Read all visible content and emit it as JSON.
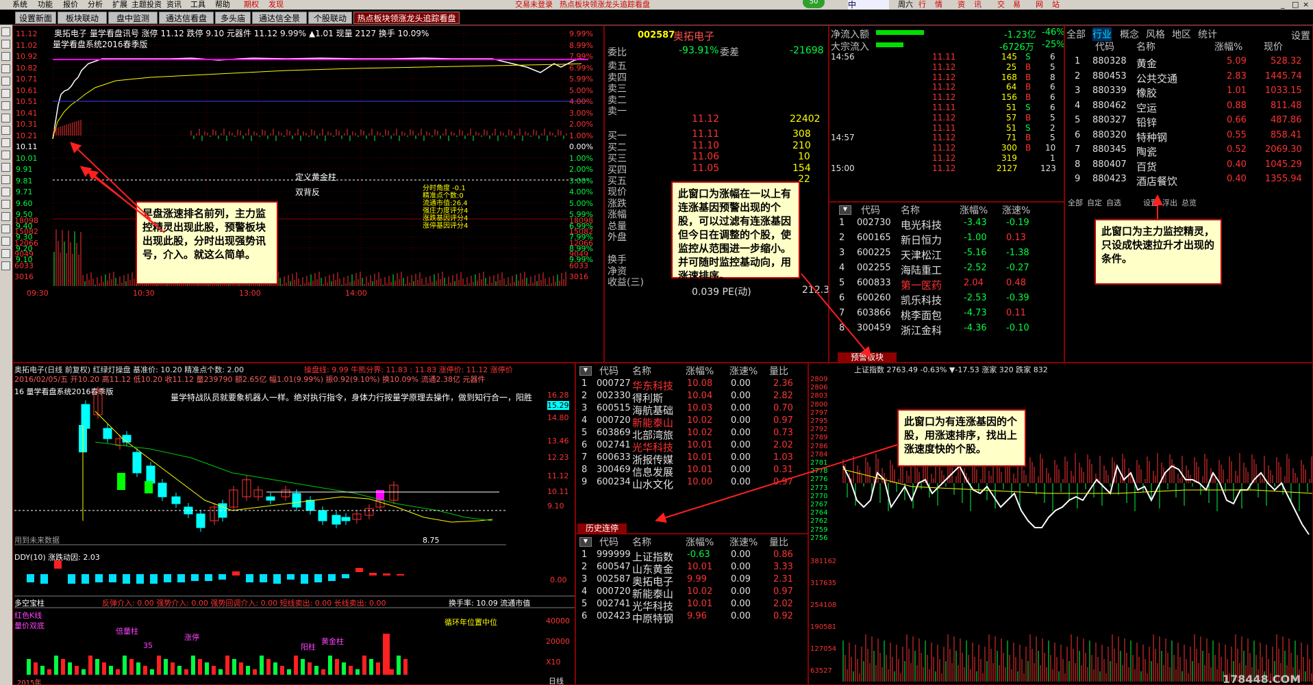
{
  "menubar": {
    "items": [
      "系统",
      "功能",
      "报价",
      "分析",
      "扩展",
      "主题投资",
      "资讯",
      "工具",
      "帮助"
    ],
    "items2": [
      "期权",
      "发现"
    ],
    "center1": "交易未登录",
    "center2": "热点板块领涨龙头追踪看盘",
    "ime": "中",
    "right": [
      "周六",
      "行",
      "情",
      "资",
      "讯",
      "交",
      "易",
      "网",
      "站"
    ],
    "badge": "50"
  },
  "tabs": [
    "设置新面",
    "板块联动",
    "盘中监测",
    "通达信看盘",
    "多头庙",
    "通达信全景",
    "个股联动",
    "热点板块领涨龙头追踪看盘"
  ],
  "intraday": {
    "header": "奥拓电子   量学看盘讯号  涨停 11.12  跌停 9.10  元器件  11.12  9.99%  ▲1.01  现量 2127  换手 10.09%",
    "sub": "量学看盘系统2016春季版",
    "left_prices": [
      "11.12",
      "11.02",
      "10.92",
      "10.82",
      "10.71",
      "10.61",
      "10.51",
      "10.41",
      "10.31",
      "10.21",
      "10.11",
      "10.01",
      "9.91",
      "9.81",
      "9.71",
      "9.60",
      "9.50",
      "9.40",
      "9.30",
      "9.20",
      "9.10"
    ],
    "vol_ticks": [
      "18098",
      "15082",
      "12066",
      "9049",
      "6033",
      "3016"
    ],
    "right_pcts": [
      "9.99%",
      "8.99%",
      "7.99%",
      "6.99%",
      "5.99%",
      "5.00%",
      "4.00%",
      "3.00%",
      "2.00%",
      "1.00%",
      "0.00%",
      "1.00%",
      "2.00%",
      "3.00%",
      "4.00%",
      "5.00%",
      "5.99%",
      "6.99%",
      "7.99%",
      "8.99%",
      "9.99%"
    ],
    "times": [
      "09:30",
      "10:30",
      "13:00",
      "14:00"
    ],
    "notes": [
      "定义黄金柱",
      "双背反"
    ],
    "right_notes": [
      "分时角度 -0.1",
      "精准点个数:0",
      "流通市值:26.4",
      "强庄力度评分4",
      "涨跌基因评分4",
      "涨停基因评分4"
    ]
  },
  "callouts": {
    "c1": "早盘涨速排名前列，主力监控精灵出现此股，预警板块出现此股，分时出现强势讯号，介入。就这么简单。",
    "c2": "此窗口为涨幅在一以上有连涨基因预警出现的个股，可以过滤有连涨基因但今日在调整的个股，使监控从范围进一步缩小。并可随时监控基动向，用涨速排序。",
    "c3": "此窗口为主力监控精灵，只设成快速拉升才出现的条件。",
    "c4": "此窗口为有连涨基因的个股，用涨速排序，找出上涨速度快的个股。"
  },
  "quote": {
    "code": "002587",
    "name": "奥拓电子",
    "wb_label": "委比",
    "wb_val": "-93.91%",
    "wc_label": "委差",
    "wc_val": "-21698",
    "sells": [
      "卖五",
      "卖四",
      "卖三",
      "卖二",
      "卖一"
    ],
    "sell1_price": "11.12",
    "sell1_vol": "22402",
    "buys": [
      {
        "l": "买一",
        "p": "11.11",
        "v": "308"
      },
      {
        "l": "买二",
        "p": "11.10",
        "v": "210"
      },
      {
        "l": "买三",
        "p": "11.06",
        "v": "10"
      },
      {
        "l": "买四",
        "p": "11.05",
        "v": "154"
      },
      {
        "l": "买五",
        "p": "",
        "v": "22"
      }
    ],
    "misc": [
      "现价",
      "涨跌",
      "涨幅",
      "总量",
      "外盘",
      "",
      "换手",
      "净资",
      "收益(三)"
    ],
    "pe_label": "0.039 PE(动)",
    "pe_val": "212.3"
  },
  "flow": {
    "l1": "净流入额",
    "v1a": "-1.23亿",
    "v1b": "-46%",
    "l2": "大宗流入",
    "v2a": "-6726万",
    "v2b": "-25%",
    "ticks": [
      {
        "t": "14:56",
        "p": "11.11",
        "v": "145",
        "d": "S",
        "n": "6"
      },
      {
        "t": "",
        "p": "11.12",
        "v": "25",
        "d": "B",
        "n": "5"
      },
      {
        "t": "",
        "p": "11.12",
        "v": "168",
        "d": "B",
        "n": "8"
      },
      {
        "t": "",
        "p": "11.12",
        "v": "64",
        "d": "B",
        "n": "6"
      },
      {
        "t": "",
        "p": "11.12",
        "v": "156",
        "d": "B",
        "n": "6"
      },
      {
        "t": "",
        "p": "11.11",
        "v": "51",
        "d": "S",
        "n": "6"
      },
      {
        "t": "",
        "p": "11.12",
        "v": "57",
        "d": "B",
        "n": "5"
      },
      {
        "t": "",
        "p": "11.11",
        "v": "51",
        "d": "S",
        "n": "2"
      },
      {
        "t": "14:57",
        "p": "11.12",
        "v": "71",
        "d": "B",
        "n": "5"
      },
      {
        "t": "",
        "p": "11.12",
        "v": "300",
        "d": "B",
        "n": "10"
      },
      {
        "t": "",
        "p": "11.12",
        "v": "319",
        "d": "",
        "n": "1"
      },
      {
        "t": "15:00",
        "p": "11.12",
        "v": "2127",
        "d": "",
        "n": "123"
      }
    ]
  },
  "alert": {
    "headers": [
      "代码",
      "名称",
      "涨幅%",
      "涨速%"
    ],
    "rows": [
      {
        "i": "1",
        "c": "002730",
        "n": "电光科技",
        "r": "-3.43",
        "s": "-0.19"
      },
      {
        "i": "2",
        "c": "600165",
        "n": "新日恒力",
        "r": "-1.00",
        "s": "0.13"
      },
      {
        "i": "3",
        "c": "600225",
        "n": "天津松江",
        "r": "-5.16",
        "s": "-1.38"
      },
      {
        "i": "4",
        "c": "002255",
        "n": "海陆重工",
        "r": "-2.52",
        "s": "-0.27"
      },
      {
        "i": "5",
        "c": "600833",
        "n": "第一医药",
        "r": "2.04",
        "s": "0.48"
      },
      {
        "i": "6",
        "c": "600260",
        "n": "凯乐科技",
        "r": "-2.53",
        "s": "-0.39"
      },
      {
        "i": "7",
        "c": "603866",
        "n": "桃李面包",
        "r": "-4.73",
        "s": "0.11"
      },
      {
        "i": "8",
        "c": "300459",
        "n": "浙江金科",
        "r": "-4.36",
        "s": "-0.10"
      }
    ],
    "btn": "预警板块"
  },
  "sector": {
    "tabs": [
      "全部",
      "行业",
      "概念",
      "风格",
      "地区",
      "统计"
    ],
    "settings": "设置",
    "headers": [
      "代码",
      "名称",
      "涨幅%",
      "现价"
    ],
    "rows": [
      {
        "i": "1",
        "c": "880328",
        "n": "黄金",
        "r": "5.09",
        "p": "528.32"
      },
      {
        "i": "2",
        "c": "880453",
        "n": "公共交通",
        "r": "2.83",
        "p": "1445.74"
      },
      {
        "i": "3",
        "c": "880339",
        "n": "橡胶",
        "r": "1.01",
        "p": "1033.15"
      },
      {
        "i": "4",
        "c": "880462",
        "n": "空运",
        "r": "0.88",
        "p": "811.48"
      },
      {
        "i": "5",
        "c": "880327",
        "n": "铅锌",
        "r": "0.66",
        "p": "487.86"
      },
      {
        "i": "6",
        "c": "880320",
        "n": "特种钢",
        "r": "0.55",
        "p": "858.41"
      },
      {
        "i": "7",
        "c": "880345",
        "n": "陶瓷",
        "r": "0.52",
        "p": "2069.30"
      },
      {
        "i": "8",
        "c": "880407",
        "n": "百货",
        "r": "0.40",
        "p": "1045.29"
      },
      {
        "i": "9",
        "c": "880423",
        "n": "酒店餐饮",
        "r": "0.40",
        "p": "1355.94"
      }
    ],
    "bottom": [
      "全部",
      "自定",
      "自选",
      "设置",
      "浮出",
      "总览"
    ]
  },
  "daily": {
    "header": "奥拓电子(日线 前复权) 红绿灯操盘 基准价: 10.20  精准点个数: 2.00",
    "header2": "操盘线: 9.99  牛熊分界: 11.83  : 11.83  涨停价: 11.12  涨停价",
    "date_line": "2016/02/05/五  开10.20 高11.12 低10.20 收11.12 量239790 额2.65亿 幅1.01(9.99%) 振0.92(9.10%) 换10.09% 流通2.38亿 元器件",
    "ver": "16 量学看盘系统2016春季版",
    "motto": "量学特战队员就要象机器人一样。绝对执行指令，身体力行按量学原理去操作，做到知行合一，阳胜",
    "prices": [
      "16.28",
      "15.29",
      "14.80",
      "13.46",
      "12.23",
      "11.12",
      "10.11",
      "9.10"
    ],
    "lowlabel": "8.75",
    "future": "用到未来数据",
    "ddy": "DDY(10)  涨跌动因: 2.03",
    "ddy_zero": "0.00",
    "bottom1": "多空宝柱",
    "bottom2": "反弹介入: 0.00  强势介入: 0.00  强势回调介入: 0.00   短线卖出: 0.00  长线卖出: 0.00",
    "bottom3": "换手率: 10.09  流通市值",
    "vol_ticks": [
      "40000",
      "20000",
      "X10"
    ],
    "year": "2015年",
    "day": "日线",
    "circle": "循环年位置中位",
    "left_labels": [
      "红色K线",
      "量价双底",
      "倍量柱",
      "35",
      "阳柱",
      "涨停",
      "黄金柱"
    ]
  },
  "lianzhang": {
    "headers": [
      "代码",
      "名称",
      "涨幅%",
      "涨速%",
      "量比"
    ],
    "rows": [
      {
        "i": "1",
        "c": "000727",
        "n": "华东科技",
        "r": "10.08",
        "s": "0.00",
        "q": "2.36"
      },
      {
        "i": "2",
        "c": "002330",
        "n": "得利斯",
        "r": "10.04",
        "s": "0.00",
        "q": "2.82"
      },
      {
        "i": "3",
        "c": "600515",
        "n": "海航基础",
        "r": "10.03",
        "s": "0.00",
        "q": "0.70"
      },
      {
        "i": "4",
        "c": "000720",
        "n": "新能泰山",
        "r": "10.02",
        "s": "0.00",
        "q": "0.97"
      },
      {
        "i": "5",
        "c": "603869",
        "n": "北部湾旅",
        "r": "10.02",
        "s": "0.00",
        "q": "0.73"
      },
      {
        "i": "6",
        "c": "002741",
        "n": "光华科技",
        "r": "10.01",
        "s": "0.00",
        "q": "2.02"
      },
      {
        "i": "7",
        "c": "600633",
        "n": "浙报传媒",
        "r": "10.01",
        "s": "0.00",
        "q": "1.03"
      },
      {
        "i": "8",
        "c": "300469",
        "n": "信息发展",
        "r": "10.01",
        "s": "0.00",
        "q": "0.31"
      },
      {
        "i": "9",
        "c": "600234",
        "n": "山水文化",
        "r": "10.00",
        "s": "0.00",
        "q": "0.97"
      }
    ],
    "btn": "历史连停"
  },
  "history": {
    "headers": [
      "代码",
      "名称",
      "涨幅%",
      "涨速%",
      "量比"
    ],
    "rows": [
      {
        "i": "1",
        "c": "999999",
        "n": "上证指数",
        "r": "-0.63",
        "s": "0.00",
        "q": "0.86"
      },
      {
        "i": "2",
        "c": "600547",
        "n": "山东黄金",
        "r": "10.01",
        "s": "0.00",
        "q": "3.33"
      },
      {
        "i": "3",
        "c": "002587",
        "n": "奥拓电子",
        "r": "9.99",
        "s": "0.09",
        "q": "2.31"
      },
      {
        "i": "4",
        "c": "000720",
        "n": "新能泰山",
        "r": "10.02",
        "s": "0.00",
        "q": "0.97"
      },
      {
        "i": "5",
        "c": "002741",
        "n": "光华科技",
        "r": "10.01",
        "s": "0.00",
        "q": "2.02"
      },
      {
        "i": "6",
        "c": "002423",
        "n": "中原特钢",
        "r": "9.96",
        "s": "0.00",
        "q": "0.92"
      }
    ]
  },
  "index": {
    "header": "上证指数  2763.49  -0.63%  ▼-17.53  涨家 320  跌家 832",
    "prices": [
      "2809",
      "2806",
      "2803",
      "2800",
      "2797",
      "2795",
      "2792",
      "2789",
      "2786",
      "2784",
      "2781",
      "2778",
      "2776",
      "2773",
      "2770",
      "2767",
      "2764",
      "2762",
      "2759",
      "2756"
    ],
    "vol": [
      "381162",
      "317635",
      "254108",
      "190581",
      "127054",
      "63527"
    ],
    "watermark": "178448.COM"
  }
}
